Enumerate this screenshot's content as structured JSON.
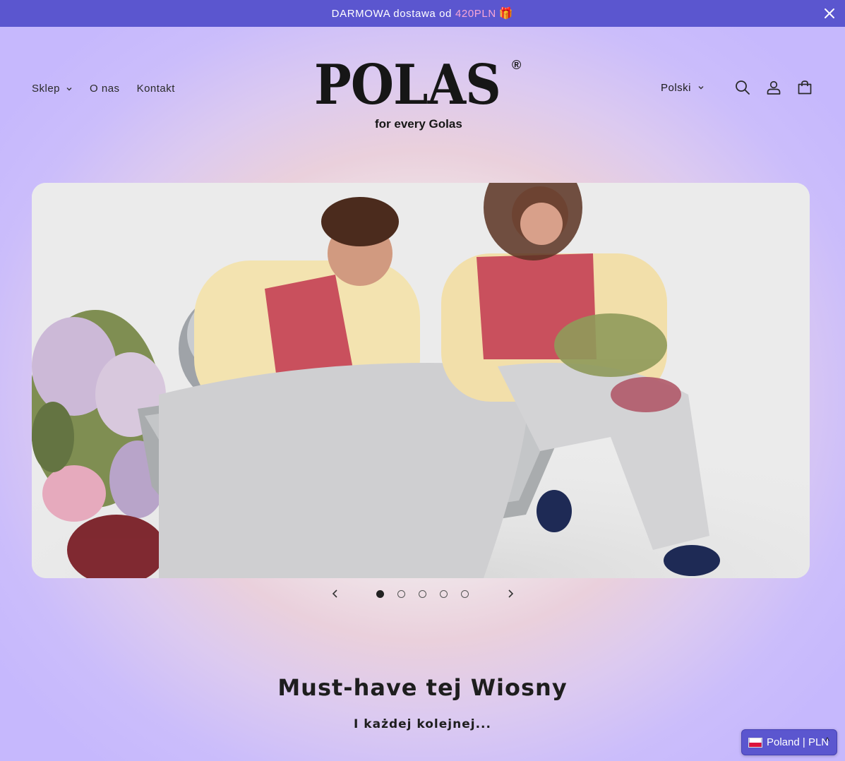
{
  "announcement": {
    "text": "DARMOWA dostawa od",
    "price": "420PLN",
    "gift": "🎁"
  },
  "nav": {
    "shop": "Sklep",
    "about": "O nas",
    "contact": "Kontakt"
  },
  "logo": {
    "brand": "POLAS",
    "registered": "®",
    "tagline": "for every Golas"
  },
  "header_right": {
    "language": "Polski",
    "icons": [
      "search-icon",
      "account-icon",
      "cart-icon"
    ]
  },
  "hero": {
    "slide_count": 5,
    "active_slide": 1
  },
  "section": {
    "title": "Must-have tej Wiosny",
    "subtitle": "I każdej kolejnej..."
  },
  "country_selector": {
    "label": "Poland | PLN",
    "caret": "^"
  },
  "colors": {
    "accent": "#5b56cf",
    "price": "#f7a6d6",
    "text": "#1b1b1b"
  }
}
